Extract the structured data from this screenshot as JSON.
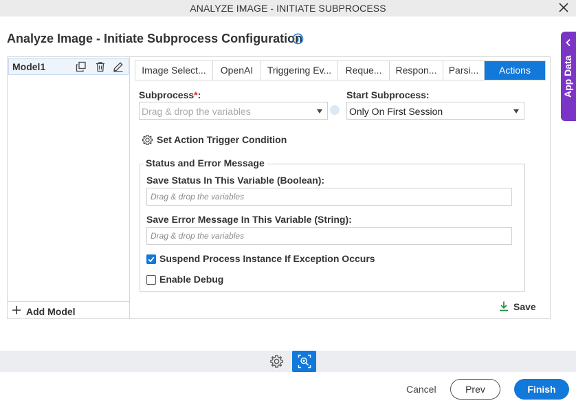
{
  "window": {
    "title": "ANALYZE IMAGE - INITIATE SUBPROCESS"
  },
  "page": {
    "heading": "Analyze Image - Initiate Subprocess Configuration"
  },
  "app_data_tab": {
    "label": "App Data"
  },
  "models": {
    "items": [
      {
        "name": "Model1"
      }
    ],
    "add_label": "Add Model"
  },
  "tabs": [
    {
      "label": "Image Select..."
    },
    {
      "label": "OpenAI"
    },
    {
      "label": "Triggering Ev..."
    },
    {
      "label": "Reque..."
    },
    {
      "label": "Respon..."
    },
    {
      "label": "Parsi..."
    },
    {
      "label": "Actions"
    }
  ],
  "active_tab": "Actions",
  "form": {
    "subprocess": {
      "label": "Subprocess",
      "required_mark": "*",
      "suffix": ":",
      "placeholder": "Drag & drop the variables"
    },
    "start_subprocess": {
      "label": "Start Subprocess:",
      "value": "Only On First Session"
    },
    "trigger_condition": {
      "label": "Set Action Trigger Condition"
    },
    "status_group": {
      "legend": "Status and Error Message",
      "save_status": {
        "label": "Save Status In This Variable (Boolean):",
        "placeholder": "Drag & drop the variables"
      },
      "save_error": {
        "label": "Save Error Message In This Variable (String):",
        "placeholder": "Drag & drop the variables"
      },
      "suspend": {
        "label": "Suspend Process Instance If Exception Occurs",
        "checked": true
      },
      "debug": {
        "label": "Enable Debug",
        "checked": false
      }
    },
    "save_label": "Save"
  },
  "footer": {
    "cancel_label": "Cancel",
    "prev_label": "Prev",
    "finish_label": "Finish"
  },
  "colors": {
    "accent": "#1278d9",
    "app_data": "#7b35c6",
    "required": "#d9262c"
  },
  "icons": [
    "close-icon",
    "info-icon",
    "chevron-left-icon",
    "copy-icon",
    "delete-icon",
    "edit-icon",
    "plus-icon",
    "gear-icon",
    "download-icon",
    "checkmark-icon",
    "image-search-icon"
  ]
}
